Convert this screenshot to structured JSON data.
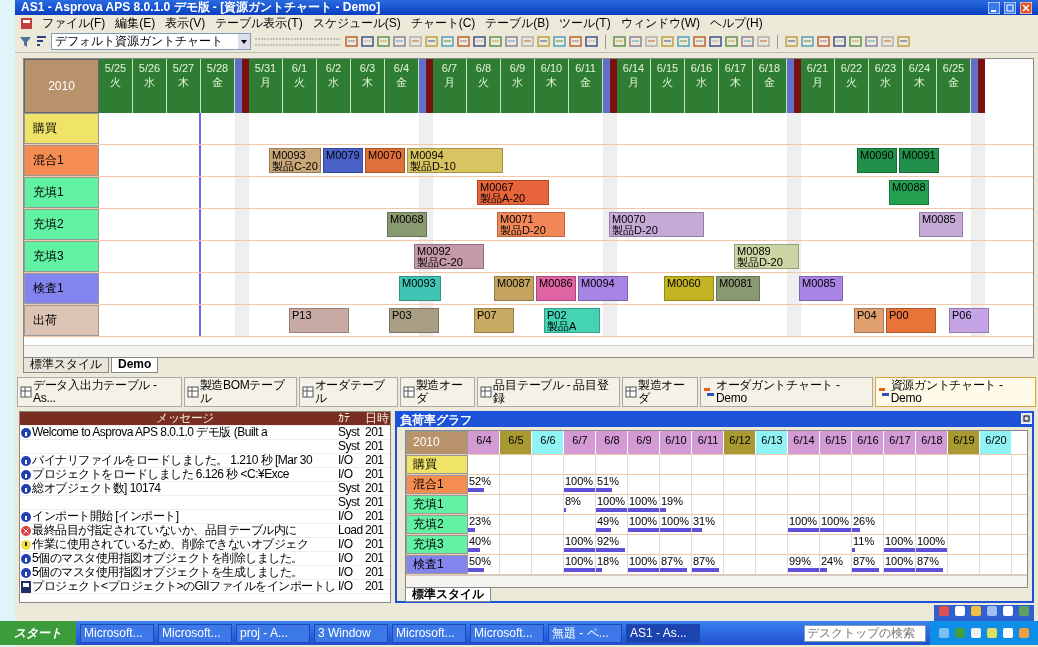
{
  "window": {
    "title": "AS1 - Asprova APS 8.0.1.0 デモ版 - [資源ガントチャート - Demo]"
  },
  "menu": [
    "ファイル(F)",
    "編集(E)",
    "表示(V)",
    "テーブル表示(T)",
    "スケジュール(S)",
    "チャート(C)",
    "テーブル(B)",
    "ツール(T)",
    "ウィンドウ(W)",
    "ヘルプ(H)"
  ],
  "toolbar": {
    "chart_select": "デフォルト資源ガントチャート"
  },
  "gantt": {
    "year": "2010",
    "days": [
      {
        "kind": "day",
        "date": "5/25",
        "weekday": "火"
      },
      {
        "kind": "day",
        "date": "5/26",
        "weekday": "水"
      },
      {
        "kind": "day",
        "date": "5/27",
        "weekday": "木"
      },
      {
        "kind": "day",
        "date": "5/28",
        "weekday": "金"
      },
      {
        "kind": "weekend"
      },
      {
        "kind": "day",
        "date": "5/31",
        "weekday": "月"
      },
      {
        "kind": "day",
        "date": "6/1",
        "weekday": "火"
      },
      {
        "kind": "day",
        "date": "6/2",
        "weekday": "水"
      },
      {
        "kind": "day",
        "date": "6/3",
        "weekday": "木"
      },
      {
        "kind": "day",
        "date": "6/4",
        "weekday": "金"
      },
      {
        "kind": "weekend"
      },
      {
        "kind": "day",
        "date": "6/7",
        "weekday": "月"
      },
      {
        "kind": "day",
        "date": "6/8",
        "weekday": "火"
      },
      {
        "kind": "day",
        "date": "6/9",
        "weekday": "水"
      },
      {
        "kind": "day",
        "date": "6/10",
        "weekday": "木"
      },
      {
        "kind": "day",
        "date": "6/11",
        "weekday": "金"
      },
      {
        "kind": "weekend"
      },
      {
        "kind": "day",
        "date": "6/14",
        "weekday": "月"
      },
      {
        "kind": "day",
        "date": "6/15",
        "weekday": "火"
      },
      {
        "kind": "day",
        "date": "6/16",
        "weekday": "水"
      },
      {
        "kind": "day",
        "date": "6/17",
        "weekday": "木"
      },
      {
        "kind": "day",
        "date": "6/18",
        "weekday": "金"
      },
      {
        "kind": "weekend"
      },
      {
        "kind": "day",
        "date": "6/21",
        "weekday": "月"
      },
      {
        "kind": "day",
        "date": "6/22",
        "weekday": "火"
      },
      {
        "kind": "day",
        "date": "6/23",
        "weekday": "水"
      },
      {
        "kind": "day",
        "date": "6/24",
        "weekday": "木"
      },
      {
        "kind": "day",
        "date": "6/25",
        "weekday": "金"
      },
      {
        "kind": "weekend"
      }
    ],
    "resources": [
      {
        "name": "購買",
        "color": "#f0e468"
      },
      {
        "name": "混合1",
        "color": "#f58c52",
        "bars": [
          {
            "label": "M0093",
            "sub": "製品C-20",
            "color": "#c8a878"
          },
          {
            "label": "M0079",
            "color": "#4a62c8"
          },
          {
            "label": "M0070",
            "color": "#e0703a"
          },
          {
            "label": "M0094",
            "sub": "製品D-10",
            "color": "#d8c460"
          },
          {
            "label": "M0090",
            "color": "#22904a"
          },
          {
            "label": "M0091",
            "color": "#22904a"
          }
        ]
      },
      {
        "name": "充填1",
        "color": "#62f2a4",
        "bars": [
          {
            "label": "M0067",
            "sub": "製品A-20",
            "color": "#e8643a"
          },
          {
            "label": "M0088",
            "color": "#22a050"
          }
        ]
      },
      {
        "name": "充填2",
        "color": "#62f2a4",
        "bars": [
          {
            "label": "M0068",
            "color": "#8a9a70"
          },
          {
            "label": "M0071",
            "sub": "製品D-20",
            "color": "#f28858"
          },
          {
            "label": "M0070",
            "sub": "製品D-20",
            "color": "#c4aad4"
          },
          {
            "label": "M0085",
            "color": "#c4aad4"
          }
        ]
      },
      {
        "name": "充填3",
        "color": "#62f2a4",
        "bars": [
          {
            "label": "M0092",
            "sub": "製品C-20",
            "color": "#c49aa8"
          },
          {
            "label": "M0089",
            "sub": "製品D-20",
            "color": "#ccd4a4"
          }
        ]
      },
      {
        "name": "検査1",
        "color": "#8484ee",
        "bars": [
          {
            "label": "M0093",
            "color": "#40c4b4"
          },
          {
            "label": "M0087",
            "color": "#c4a460"
          },
          {
            "label": "M0086",
            "color": "#e064a4"
          },
          {
            "label": "M0094",
            "color": "#a884e4"
          },
          {
            "label": "M0060",
            "color": "#c4b424"
          },
          {
            "label": "M0081",
            "color": "#8a9a70"
          },
          {
            "label": "M0085",
            "color": "#a884e4"
          }
        ]
      },
      {
        "name": "出荷",
        "color": "#dcc4b4",
        "bars": [
          {
            "label": "P13",
            "color": "#c8aaa4"
          },
          {
            "label": "P03",
            "color": "#a89e84"
          },
          {
            "label": "P07",
            "color": "#c8aa64"
          },
          {
            "label": "P02",
            "sub": "製品A",
            "color": "#44d4b4"
          },
          {
            "label": "P04",
            "color": "#e0a070"
          },
          {
            "label": "P00",
            "color": "#e8743a"
          },
          {
            "label": "P06",
            "color": "#c4a4e4"
          }
        ]
      }
    ]
  },
  "style_tabs": [
    {
      "label": "標準スタイル",
      "selected": false
    },
    {
      "label": "Demo",
      "selected": true
    }
  ],
  "window_tabs": [
    {
      "label": "データ入出力テーブル - As...",
      "kind": "table",
      "selected": false
    },
    {
      "label": "製造BOMテーブル",
      "kind": "table",
      "selected": false
    },
    {
      "label": "オーダテーブル",
      "kind": "table",
      "selected": false
    },
    {
      "label": "製造オーダ",
      "kind": "table",
      "selected": false
    },
    {
      "label": "品目テーブル - 品目登録",
      "kind": "table",
      "selected": false
    },
    {
      "label": "製造オーダ",
      "kind": "table",
      "selected": false
    },
    {
      "label": "オーダガントチャート - Demo",
      "kind": "chart",
      "selected": false
    },
    {
      "label": "資源ガントチャート - Demo",
      "kind": "chart",
      "selected": true
    }
  ],
  "messages": {
    "columns": [
      "メッセージ",
      "ｶﾃ",
      "日時"
    ],
    "rows": [
      {
        "kind": "info",
        "text": "Welcome to Asprova APS 8.0.1.0 デモ版 (Built a",
        "category": "Syst",
        "time": "201"
      },
      {
        "kind": "none",
        "category": "Syst",
        "time": "201"
      },
      {
        "kind": "info",
        "text": "バイナリファイルをロードしました。 1.210 秒 [Mar 30",
        "category": "I/O",
        "time": "201"
      },
      {
        "kind": "info",
        "text": "プロジェクトをロードしました 6.126 秒 <C:¥Exce",
        "category": "I/O",
        "time": "201"
      },
      {
        "kind": "info",
        "text": "総オブジェクト数] 10174",
        "category": "Syst",
        "time": "201"
      },
      {
        "kind": "none",
        "category": "Syst",
        "time": "201"
      },
      {
        "kind": "info",
        "text": "インポート開始 [インポート]",
        "category": "I/O",
        "time": "201"
      },
      {
        "kind": "error",
        "text": "最終品目が指定されていないか、品目テーブル内に",
        "category": "Load",
        "time": "201"
      },
      {
        "kind": "warning",
        "text": "作業に使用されているため、削除できないオブジェク",
        "category": "I/O",
        "time": "201"
      },
      {
        "kind": "info",
        "text": "5個のマスタ使用指図オブジェクトを削除しました。",
        "category": "I/O",
        "time": "201"
      },
      {
        "kind": "info",
        "text": "5個のマスタ使用指図オブジェクトを生成しました。",
        "category": "I/O",
        "time": "201"
      },
      {
        "kind": "document",
        "text": "プロジェクト<プロジェクト>のGIIファイルをインポートし",
        "category": "I/O",
        "time": "201"
      }
    ]
  },
  "load_graph": {
    "title": "負荷率グラフ",
    "year": "2010",
    "tab": "標準スタイル",
    "days": [
      {
        "date": "6/4",
        "color": "#d49ad4"
      },
      {
        "date": "6/5",
        "color": "#a89a30"
      },
      {
        "date": "6/6",
        "color": "#90f4f4"
      },
      {
        "date": "6/7",
        "color": "#d49ad4"
      },
      {
        "date": "6/8",
        "color": "#d49ad4"
      },
      {
        "date": "6/9",
        "color": "#d49ad4"
      },
      {
        "date": "6/10",
        "color": "#d49ad4"
      },
      {
        "date": "6/11",
        "color": "#d49ad4"
      },
      {
        "date": "6/12",
        "color": "#a89a30"
      },
      {
        "date": "6/13",
        "color": "#90f4f4"
      },
      {
        "date": "6/14",
        "color": "#d49ad4"
      },
      {
        "date": "6/15",
        "color": "#d49ad4"
      },
      {
        "date": "6/16",
        "color": "#d49ad4"
      },
      {
        "date": "6/17",
        "color": "#d49ad4"
      },
      {
        "date": "6/18",
        "color": "#d49ad4"
      },
      {
        "date": "6/19",
        "color": "#a89a30"
      },
      {
        "date": "6/20",
        "color": "#90f4f4"
      }
    ],
    "resources": [
      {
        "name": "購買",
        "color": "#f0e468",
        "cells": [
          null,
          null,
          null,
          null,
          null,
          null,
          null,
          null,
          null,
          null,
          null,
          null,
          null,
          null,
          null,
          null,
          null
        ]
      },
      {
        "name": "混合1",
        "color": "#f58c52",
        "cells": [
          {
            "text": "52%",
            "level": 0.52
          },
          null,
          null,
          {
            "text": "100%",
            "level": 1
          },
          {
            "text": "51%",
            "level": 0.51
          },
          null,
          null,
          null,
          null,
          null,
          null,
          null,
          null,
          null,
          null,
          null,
          null
        ]
      },
      {
        "name": "充填1",
        "color": "#62f2a4",
        "cells": [
          null,
          null,
          null,
          {
            "text": "8%",
            "level": 0.08
          },
          {
            "text": "100%",
            "level": 1
          },
          {
            "text": "100%",
            "level": 1
          },
          {
            "text": "19%",
            "level": 0.19
          },
          null,
          null,
          null,
          null,
          null,
          null,
          null,
          null,
          null,
          null
        ]
      },
      {
        "name": "充填2",
        "color": "#62f2a4",
        "cells": [
          {
            "text": "23%",
            "level": 0.23
          },
          null,
          null,
          null,
          {
            "text": "49%",
            "level": 0.49
          },
          {
            "text": "100%",
            "level": 1
          },
          {
            "text": "100%",
            "level": 1
          },
          {
            "text": "31%",
            "level": 0.31
          },
          null,
          null,
          {
            "text": "100%",
            "level": 1
          },
          {
            "text": "100%",
            "level": 1
          },
          {
            "text": "26%",
            "level": 0.26
          },
          null,
          null,
          null,
          null
        ]
      },
      {
        "name": "充填3",
        "color": "#62f2a4",
        "cells": [
          {
            "text": "40%",
            "level": 0.4
          },
          null,
          null,
          {
            "text": "100%",
            "level": 1
          },
          {
            "text": "92%",
            "level": 0.92
          },
          null,
          null,
          null,
          null,
          null,
          null,
          null,
          {
            "text": "11%",
            "level": 0.11
          },
          {
            "text": "100%",
            "level": 1
          },
          {
            "text": "100%",
            "level": 1
          },
          null,
          null
        ]
      },
      {
        "name": "検査1",
        "color": "#8484ee",
        "cells": [
          {
            "text": "50%",
            "level": 0.5
          },
          null,
          null,
          {
            "text": "100%",
            "level": 1
          },
          {
            "text": "18%",
            "level": 0.18
          },
          {
            "text": "100%",
            "level": 1
          },
          {
            "text": "87%",
            "level": 0.87
          },
          {
            "text": "87%",
            "level": 0.87
          },
          null,
          null,
          {
            "text": "99%",
            "level": 0.99
          },
          {
            "text": "24%",
            "level": 0.24
          },
          {
            "text": "87%",
            "level": 0.87
          },
          {
            "text": "100%",
            "level": 1
          },
          {
            "text": "87%",
            "level": 0.87
          },
          null,
          null
        ]
      }
    ]
  },
  "taskbar": {
    "start": "スタート",
    "tasks": [
      {
        "label": "Microsoft...",
        "selected": false
      },
      {
        "label": "Microsoft...",
        "selected": false
      },
      {
        "label": "proj - A...",
        "selected": false
      },
      {
        "label": "3 Window",
        "selected": false
      },
      {
        "label": "Microsoft...",
        "selected": false
      },
      {
        "label": "Microsoft...",
        "selected": false
      },
      {
        "label": "無題 - ペ...",
        "selected": false
      },
      {
        "label": "AS1 - As...",
        "selected": true
      }
    ],
    "search": {
      "placeholder": "デスクトップの検索"
    }
  }
}
